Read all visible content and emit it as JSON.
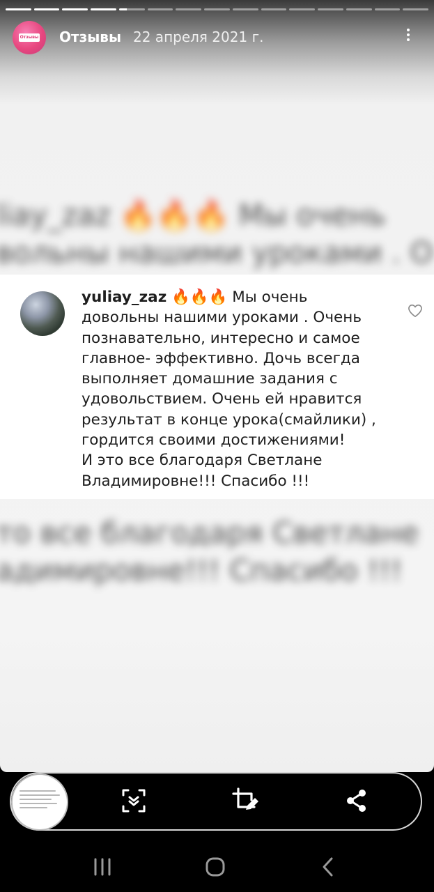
{
  "story": {
    "progress": {
      "segments_total": 15,
      "segments_done": 4,
      "current_segment_progress": 0.3
    },
    "header": {
      "title": "Отзывы",
      "date": "22 апреля 2021 г.",
      "avatar_tag": "Отзывы"
    },
    "background_text": {
      "top_lines": [
        "liay_zaz 🔥🔥🔥 Мы очень",
        "вольны нашими уроками . О"
      ],
      "bottom_lines": [
        "то все благодаря Светлане",
        "адимировне!!! Спасибо !!!"
      ]
    },
    "comment": {
      "username": "yuliay_zaz",
      "first_line_rest": "🔥🔥🔥 Мы очень",
      "lines": [
        "довольны нашими уроками . Очень",
        "познавательно, интересно и самое",
        "главное- эффективно.  Дочь всегда",
        "выполняет домашние задания с",
        "удовольствием. Очень ей нравится",
        "результат в конце урока(смайлики) ,",
        "гордится своими достижениями!",
        "И это все благодаря Светлане",
        "Владимировне!!! Спасибо !!!"
      ]
    }
  },
  "controls": {
    "thumbnail": "screenshot-thumbnail",
    "icons": [
      "scroll-capture-icon",
      "crop-edit-icon",
      "share-icon"
    ]
  },
  "nav": {
    "icons": [
      "recents-icon",
      "home-icon",
      "back-icon"
    ]
  },
  "colors": {
    "bar": "#000000",
    "card": "#ffffff",
    "text": "#1e1e1e",
    "avatar_pink": "#e8477f"
  }
}
